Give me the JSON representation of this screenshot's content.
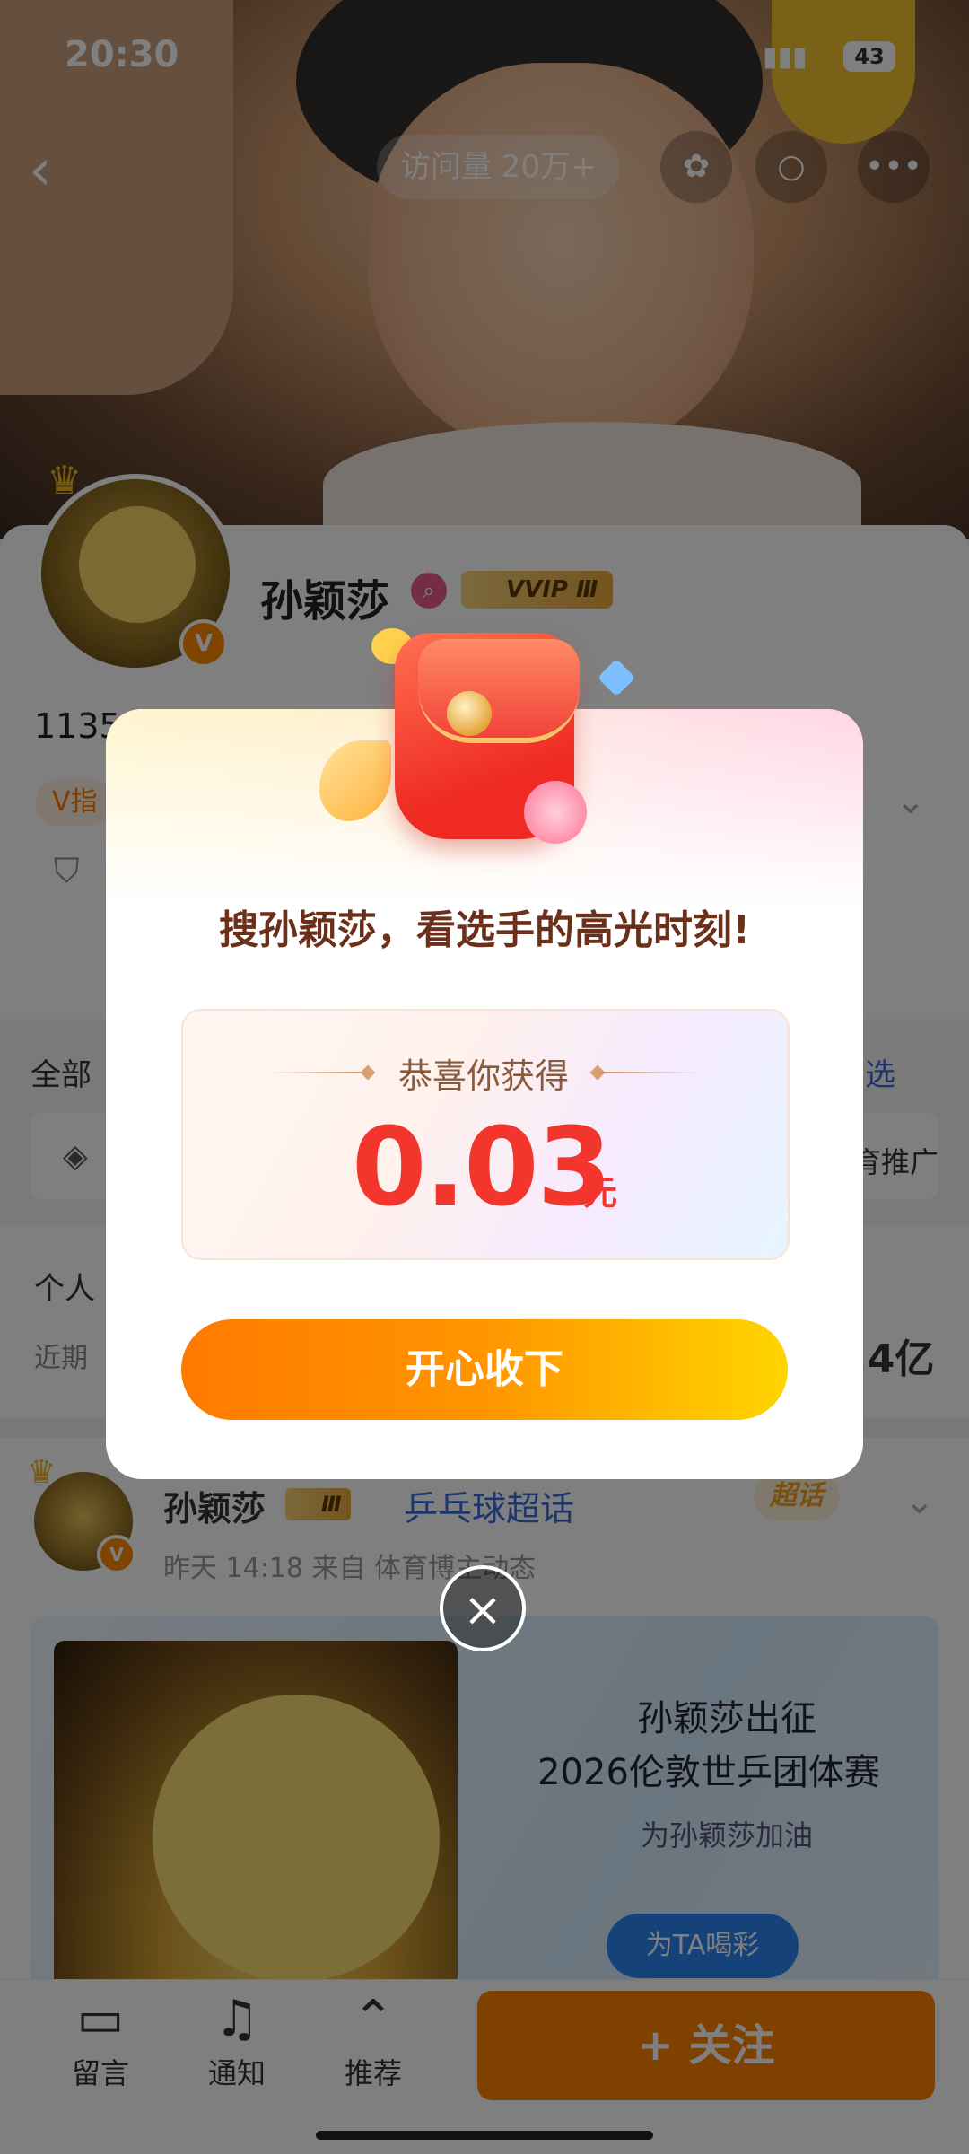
{
  "status_bar": {
    "time": "20:30",
    "battery": "43"
  },
  "top_nav": {
    "visits": "访问量 20万+"
  },
  "profile": {
    "name": "孙颖莎",
    "vip": "VVIP Ⅲ",
    "avatar_badge": "V",
    "fans_partial": "1135.7万",
    "vtag_partial": "V指"
  },
  "tabs": {
    "all_partial": "全部",
    "filter": "筛选",
    "promo_partial": "育推广"
  },
  "intro": {
    "label_partial": "个人",
    "recent_partial": "近期",
    "yi_partial": ".4亿"
  },
  "post": {
    "author": "孙颖莎",
    "vip": "Ⅲ",
    "supertopic": "乒乓球超话",
    "meta": "昨天 14:18  来自 体育博主动态",
    "chaohua": "超话",
    "banner_line1": "孙颖莎出征",
    "banner_line2": "2026伦敦世乒团体赛",
    "banner_line3": "为孙颖莎加油",
    "cheer_button": "为TA喝彩"
  },
  "bottom_bar": {
    "comment": "留言",
    "notify": "通知",
    "recommend": "推荐",
    "follow": "+ 关注"
  },
  "modal": {
    "title": "搜孙颖莎，看选手的高光时刻!",
    "prize_label": "恭喜你获得",
    "amount": "0.03",
    "unit": "元",
    "accept_button": "开心收下"
  },
  "colors": {
    "accent_orange": "#ff8200",
    "amount_red": "#f2352d",
    "link_blue": "#3a6bdb"
  }
}
